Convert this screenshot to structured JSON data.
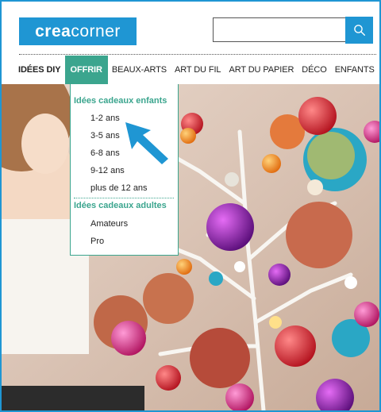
{
  "header": {
    "logo": {
      "bold": "crea",
      "light": "corner"
    },
    "search": {
      "placeholder": ""
    },
    "search_icon": "search-icon"
  },
  "nav": {
    "items": [
      {
        "label": "IDÉES DIY"
      },
      {
        "label": "OFFRIR"
      },
      {
        "label": "BEAUX-ARTS"
      },
      {
        "label": "ART DU FIL"
      },
      {
        "label": "ART DU PAPIER"
      },
      {
        "label": "DÉCO"
      },
      {
        "label": "ENFANTS"
      }
    ]
  },
  "dropdown": {
    "group1": {
      "title": "Idées cadeaux enfants",
      "items": [
        "1-2 ans",
        "3-5 ans",
        "6-8 ans",
        "9-12 ans",
        "plus de 12 ans"
      ]
    },
    "group2": {
      "title": "Idées cadeaux adultes",
      "items": [
        "Amateurs",
        "Pro"
      ]
    }
  },
  "colors": {
    "brand": "#1f96d3",
    "accent": "#3ba58e"
  }
}
